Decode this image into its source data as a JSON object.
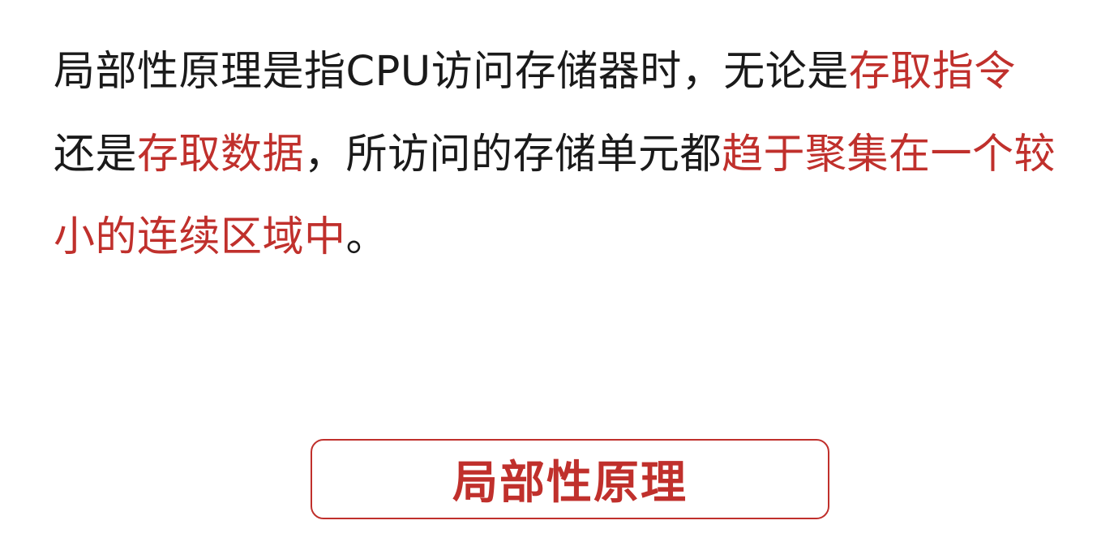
{
  "definition": {
    "segments": [
      {
        "text": "局部性原理是指CPU访问存储器时，无论是",
        "highlight": false
      },
      {
        "text": "存取指令",
        "highlight": true
      },
      {
        "text": "还是",
        "highlight": false
      },
      {
        "text": "存取数据",
        "highlight": true
      },
      {
        "text": "，所访问的存储单元都",
        "highlight": false
      },
      {
        "text": "趋于聚集在一个较小的连续区域中",
        "highlight": true
      },
      {
        "text": "。",
        "highlight": false
      }
    ]
  },
  "term_button": {
    "label": "局部性原理"
  },
  "colors": {
    "text": "#1a1a1a",
    "highlight": "#c0302c",
    "background": "#ffffff"
  }
}
